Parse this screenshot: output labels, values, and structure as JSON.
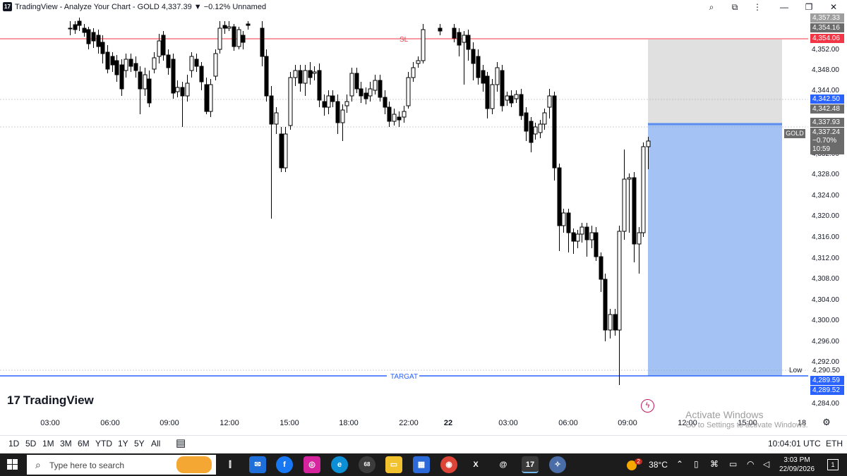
{
  "window": {
    "title": "TradingView - Analyze Your Chart - GOLD 4,337.39 ▼ −0.12% Unnamed",
    "logo_text": "17",
    "controls": [
      "search-icon",
      "screenshot-icon",
      "more-icon",
      "minimize-icon",
      "maximize-icon",
      "close-icon"
    ]
  },
  "chart": {
    "symbol": "GOLD",
    "last_price": "4,337.24",
    "change_percent": "−0.70%",
    "countdown": "10:59",
    "annotations": {
      "sl_label": "SL",
      "target_label": "TARGAT",
      "low_label": "Low"
    },
    "price_axis_ticks": [
      "4,352.00",
      "4,348.00",
      "4,344.00",
      "4,332.00",
      "4,328.00",
      "4,324.00",
      "4,320.00",
      "4,316.00",
      "4,312.00",
      "4,308.00",
      "4,304.00",
      "4,300.00",
      "4,296.00",
      "4,292.00",
      "4,284.00"
    ],
    "price_badges": {
      "p1": "4,357.33",
      "p2": "4,354.16",
      "sl": "4,354.06",
      "p3": "4,342.50",
      "p4": "4,342.48",
      "p5": "4,337.93",
      "low": "4,290.50",
      "target1": "4,289.59",
      "target2": "4,289.52"
    },
    "time_axis": [
      "03:00",
      "06:00",
      "09:00",
      "12:00",
      "15:00",
      "18:00",
      "22:00",
      "22",
      "03:00",
      "06:00",
      "09:00",
      "12:00",
      "15:00",
      "18"
    ],
    "colors": {
      "up": "#ffffff",
      "down": "#000000",
      "sl_line": "#f23645",
      "target_line": "#2962ff",
      "profit_zone": "#a4c2f4",
      "loss_zone": "#e0e0e0",
      "badge_blue": "#2962ff",
      "badge_red": "#f23645",
      "badge_gray": "#6b6b6b"
    }
  },
  "brand": {
    "name": "TradingView",
    "mark": "17"
  },
  "range_buttons": [
    "1D",
    "5D",
    "1M",
    "3M",
    "6M",
    "YTD",
    "1Y",
    "5Y",
    "All"
  ],
  "status": {
    "clock": "10:04:01 UTC",
    "session": "ETH"
  },
  "watermark": {
    "line1": "Activate Windows",
    "line2": "Go to Settings to activate Windows."
  },
  "taskbar": {
    "search_placeholder": "Type here to search",
    "weather": "38°C",
    "weather_badge": "2",
    "time": "3:03 PM",
    "date": "22/09/2026",
    "edge_badge": "68",
    "notification_count": "1"
  }
}
